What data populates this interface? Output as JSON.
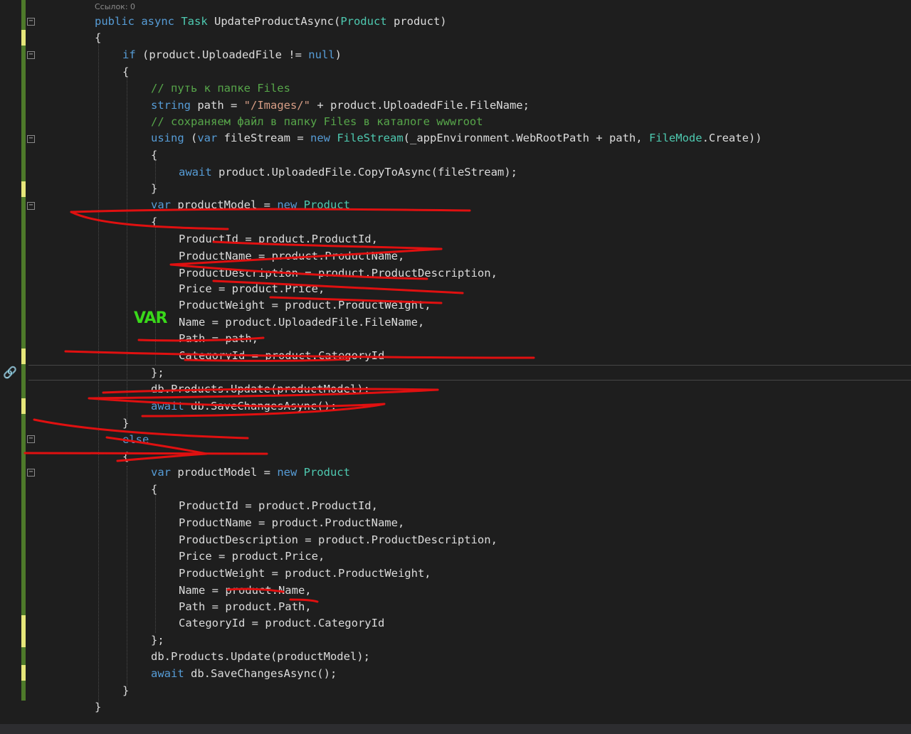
{
  "codelens": "Ссылок: 0",
  "annotation": "VAR",
  "code": [
    [
      [
        "k",
        "public "
      ],
      [
        "k",
        "async "
      ],
      [
        "t",
        "Task "
      ],
      [
        "i",
        "UpdateProductAsync("
      ],
      [
        "t",
        "Product "
      ],
      [
        "i",
        "product)"
      ]
    ],
    [
      [
        "i",
        "{"
      ]
    ],
    [
      [
        "k",
        "if "
      ],
      [
        "i",
        "(product.UploadedFile != "
      ],
      [
        "k",
        "null"
      ],
      [
        "i",
        ")"
      ]
    ],
    [
      [
        "i",
        "{"
      ]
    ],
    [
      [
        "c",
        "// путь к папке Files"
      ]
    ],
    [
      [
        "k",
        "string "
      ],
      [
        "i",
        "path = "
      ],
      [
        "s",
        "\"/Images/\""
      ],
      [
        "i",
        " + product.UploadedFile.FileName;"
      ]
    ],
    [
      [
        "c",
        "// сохраняем файл в папку Files в каталоге wwwroot"
      ]
    ],
    [
      [
        "k",
        "using "
      ],
      [
        "i",
        "("
      ],
      [
        "k",
        "var "
      ],
      [
        "i",
        "fileStream = "
      ],
      [
        "k",
        "new "
      ],
      [
        "t",
        "FileStream"
      ],
      [
        "i",
        "(_appEnvironment.WebRootPath + path, "
      ],
      [
        "t",
        "FileMode"
      ],
      [
        "i",
        ".Create))"
      ]
    ],
    [
      [
        "i",
        "{"
      ]
    ],
    [
      [
        "k",
        "await "
      ],
      [
        "i",
        "product.UploadedFile.CopyToAsync(fileStream);"
      ]
    ],
    [
      [
        "i",
        "}"
      ]
    ],
    [
      [
        "k",
        "var "
      ],
      [
        "i",
        "productModel = "
      ],
      [
        "k",
        "new "
      ],
      [
        "t",
        "Product"
      ]
    ],
    [
      [
        "i",
        "{"
      ]
    ],
    [
      [
        "i",
        "ProductId = product.ProductId,"
      ]
    ],
    [
      [
        "i",
        "ProductName = product.ProductName,"
      ]
    ],
    [
      [
        "i",
        "ProductDescription = product.ProductDescription,"
      ]
    ],
    [
      [
        "i",
        "Price = product.Price,"
      ]
    ],
    [
      [
        "i",
        "ProductWeight = product.ProductWeight,"
      ]
    ],
    [
      [
        "i",
        "Name = product.UploadedFile.FileName,"
      ]
    ],
    [
      [
        "i",
        "Path = path,"
      ]
    ],
    [
      [
        "i",
        "CategoryId = product.CategoryId"
      ]
    ],
    [
      [
        "i",
        "};"
      ]
    ],
    [
      [
        "i",
        "db.Products.Update(productModel);"
      ]
    ],
    [
      [
        "k",
        "await "
      ],
      [
        "i",
        "db.SaveChangesAsync();"
      ]
    ],
    [
      [
        "i",
        "}"
      ]
    ],
    [
      [
        "k",
        "else"
      ]
    ],
    [
      [
        "i",
        "{"
      ]
    ],
    [
      [
        "k",
        "var "
      ],
      [
        "i",
        "productModel = "
      ],
      [
        "k",
        "new "
      ],
      [
        "t",
        "Product"
      ]
    ],
    [
      [
        "i",
        "{"
      ]
    ],
    [
      [
        "i",
        "ProductId = product.ProductId,"
      ]
    ],
    [
      [
        "i",
        "ProductName = product.ProductName,"
      ]
    ],
    [
      [
        "i",
        "ProductDescription = product.ProductDescription,"
      ]
    ],
    [
      [
        "i",
        "Price = product.Price,"
      ]
    ],
    [
      [
        "i",
        "ProductWeight = product.ProductWeight,"
      ]
    ],
    [
      [
        "i",
        "Name = product.Name,"
      ]
    ],
    [
      [
        "i",
        "Path = product.Path,"
      ]
    ],
    [
      [
        "i",
        "CategoryId = product.CategoryId"
      ]
    ],
    [
      [
        "i",
        "};"
      ]
    ],
    [
      [
        "i",
        "db.Products.Update(productModel);"
      ]
    ],
    [
      [
        "k",
        "await "
      ],
      [
        "i",
        "db.SaveChangesAsync();"
      ]
    ],
    [
      [
        "i",
        "}"
      ]
    ],
    [
      [
        "i",
        "}"
      ]
    ]
  ]
}
